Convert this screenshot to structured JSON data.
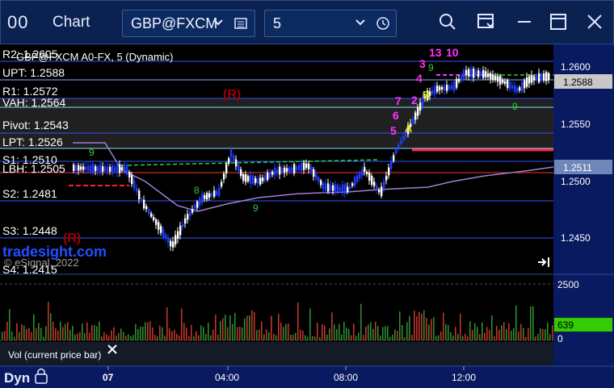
{
  "window": {
    "title_icon": "00",
    "title": "Chart",
    "symbol": "GBP@FXCM",
    "interval": "5"
  },
  "chart": {
    "header": "GBP@FXCM A0-FX, 5 (Dynamic)",
    "levels": [
      {
        "label": "R2: 1.2605"
      },
      {
        "label": "UPT: 1.2588"
      },
      {
        "label": "R1: 1.2572"
      },
      {
        "label": "VAH: 1.2564"
      },
      {
        "label": "Pivot: 1.2543"
      },
      {
        "label": "LPT: 1.2526"
      },
      {
        "label": "S1: 1.2510"
      },
      {
        "label": "LBH: 1.2505"
      },
      {
        "label": "S2: 1.2481"
      },
      {
        "label": "S3: 1.2448"
      },
      {
        "label": "S4: 1.2415"
      }
    ],
    "price_ticks": [
      "1.2600",
      "1.2550",
      "1.2500",
      "1.2450"
    ],
    "current_price": "1.2588",
    "blue_price": "1.2511",
    "markers": [
      "(R)",
      "(R)",
      "A",
      "B",
      "7",
      "6",
      "5",
      "4",
      "3",
      "2",
      "13",
      "10",
      "9",
      "9",
      "9",
      "8",
      "9"
    ],
    "watermark": "tradesight.com",
    "copyright": "© eSignal, 2022",
    "volume_label": "Vol (current price bar)",
    "volume_ticks": [
      "2500",
      "0"
    ],
    "volume_current": "639",
    "time_labels": [
      "07",
      "04:00",
      "08:00",
      "12:00"
    ],
    "dyn_label": "Dyn",
    "colors": {
      "up_candle": "#ffffff",
      "down_candle": "#1f3cff",
      "volume_up": "#2e8b2e",
      "volume_down": "#c0352a",
      "sequential": "#ff33ff",
      "green_count": "#33cc33",
      "volume_badge": "#33cc00"
    }
  },
  "chart_data": {
    "type": "candlestick",
    "axis_label_y": "",
    "ylim": [
      1.2415,
      1.262
    ]
  }
}
